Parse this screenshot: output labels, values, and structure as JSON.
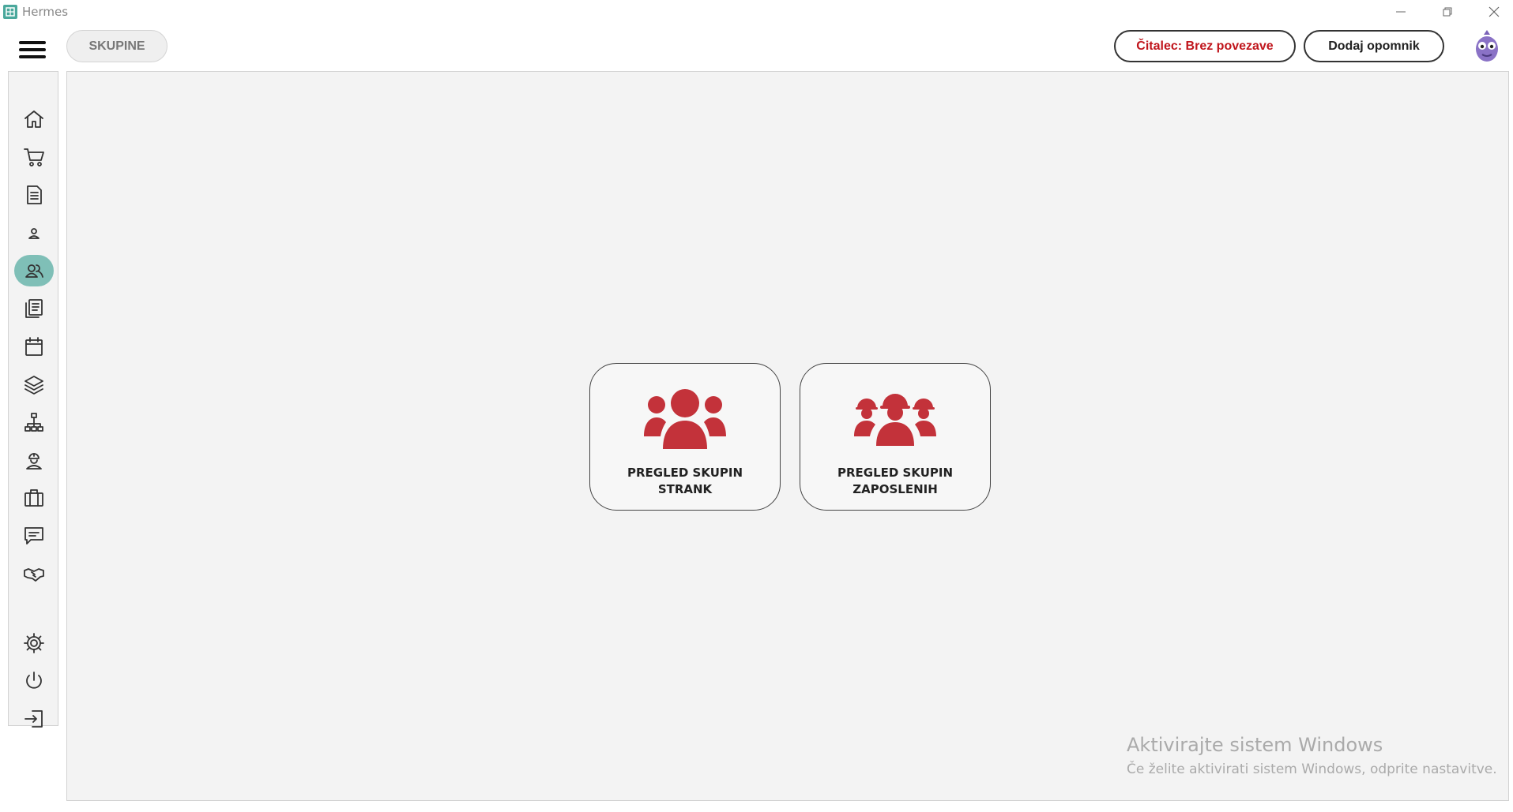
{
  "window": {
    "title": "Hermes",
    "minimize_icon": "minimize-icon",
    "maximize_icon": "restore-icon",
    "close_icon": "close-icon"
  },
  "header": {
    "section_label": "SKUPINE",
    "reader_status": "Čitalec: Brez povezave",
    "add_reminder": "Dodaj opomnik",
    "reader_color": "#c0151c"
  },
  "sidebar": {
    "accent": "#7fbfb7",
    "items": [
      {
        "icon": "home-icon"
      },
      {
        "icon": "cart-icon"
      },
      {
        "icon": "document-icon"
      },
      {
        "icon": "person-icon"
      },
      {
        "icon": "users-icon",
        "active": true
      },
      {
        "icon": "documents-stack-icon"
      },
      {
        "icon": "calendar-icon"
      },
      {
        "icon": "layers-icon"
      },
      {
        "icon": "org-chart-icon"
      },
      {
        "icon": "worker-icon"
      },
      {
        "icon": "briefcase-icon"
      },
      {
        "icon": "message-icon"
      },
      {
        "icon": "handshake-icon"
      },
      {
        "icon": "gear-icon"
      },
      {
        "icon": "power-icon"
      },
      {
        "icon": "logout-icon"
      }
    ]
  },
  "main": {
    "cards": [
      {
        "icon": "people-group-icon",
        "line1": "PREGLED SKUPIN",
        "line2": "STRANK"
      },
      {
        "icon": "hardhat-group-icon",
        "line1": "PREGLED SKUPIN",
        "line2": "ZAPOSLENIH"
      }
    ],
    "icon_color": "#c3323a"
  },
  "watermark": {
    "line1": "Aktivirajte sistem Windows",
    "line2": "Če želite aktivirati sistem Windows, odprite nastavitve."
  }
}
